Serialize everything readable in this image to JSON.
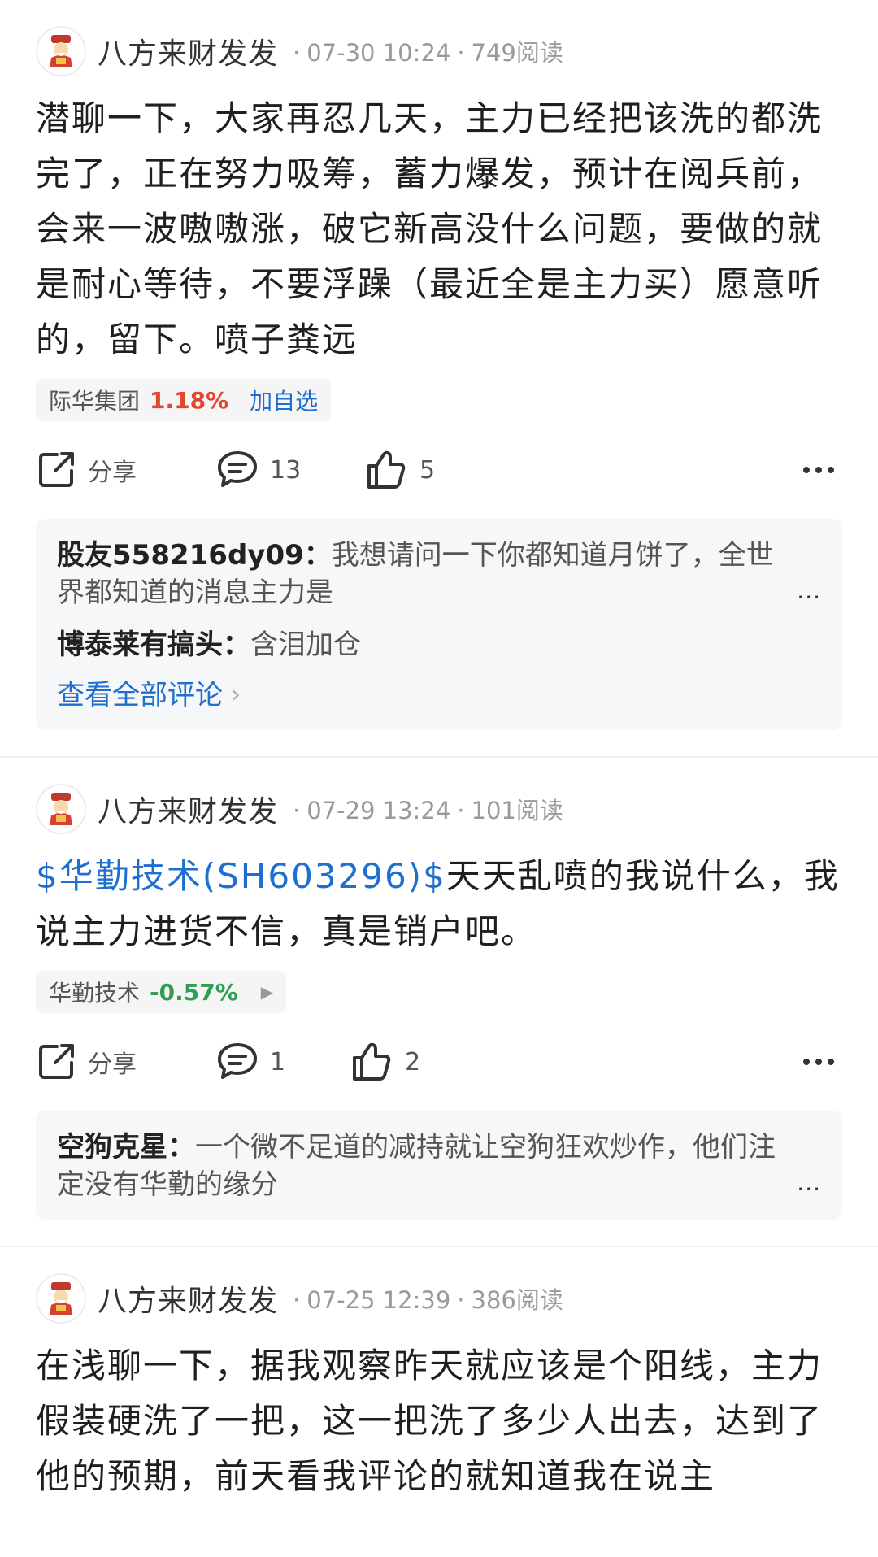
{
  "posts": [
    {
      "author": "八方来财发发",
      "date": "07-30 10:24",
      "reads": "749阅读",
      "text": "潜聊一下，大家再忍几天，主力已经把该洗的都洗完了，正在努力吸筹，蓄力爆发，预计在阅兵前，会来一波嗷嗷涨，破它新高没什么问题，要做的就是耐心等待，不要浮躁（最近全是主力买）愿意听的，留下。喷子粪远",
      "stock": {
        "name": "际华集团",
        "change": "1.18%",
        "action": "加自选"
      },
      "share_label": "分享",
      "comment_count": "13",
      "like_count": "5",
      "comments": [
        {
          "user": "股友558216dy09",
          "sep": "：",
          "text": "我想请问一下你都知道月饼了，全世界都知道的消息主力是",
          "truncated": "..."
        },
        {
          "user": "博泰莱有搞头",
          "sep": "：",
          "text": "含泪加仓"
        }
      ],
      "view_all": "查看全部评论"
    },
    {
      "author": "八方来财发发",
      "date": "07-29 13:24",
      "reads": "101阅读",
      "link": "$华勤技术(SH603296)$",
      "text": "天天乱喷的我说什么，我说主力进货不信，真是销户吧。",
      "stock": {
        "name": "华勤技术",
        "change": "-0.57%"
      },
      "share_label": "分享",
      "comment_count": "1",
      "like_count": "2",
      "comments": [
        {
          "user": "空狗克星",
          "sep": "：",
          "text": "一个微不足道的减持就让空狗狂欢炒作，他们注定没有华勤的缘分",
          "truncated": "..."
        }
      ]
    },
    {
      "author": "八方来财发发",
      "date": "07-25 12:39",
      "reads": "386阅读",
      "text": "在浅聊一下，据我观察昨天就应该是个阳线，主力假装硬洗了一把，这一把洗了多少人出去，达到了他的预期，前天看我评论的就知道我在说主"
    }
  ],
  "icons": {
    "share": "share-icon",
    "comment": "comment-icon",
    "like": "thumbs-up-icon",
    "more": "more-icon"
  },
  "colors": {
    "link": "#1f6fd0",
    "up": "#e0472e",
    "down": "#2f9e54"
  }
}
